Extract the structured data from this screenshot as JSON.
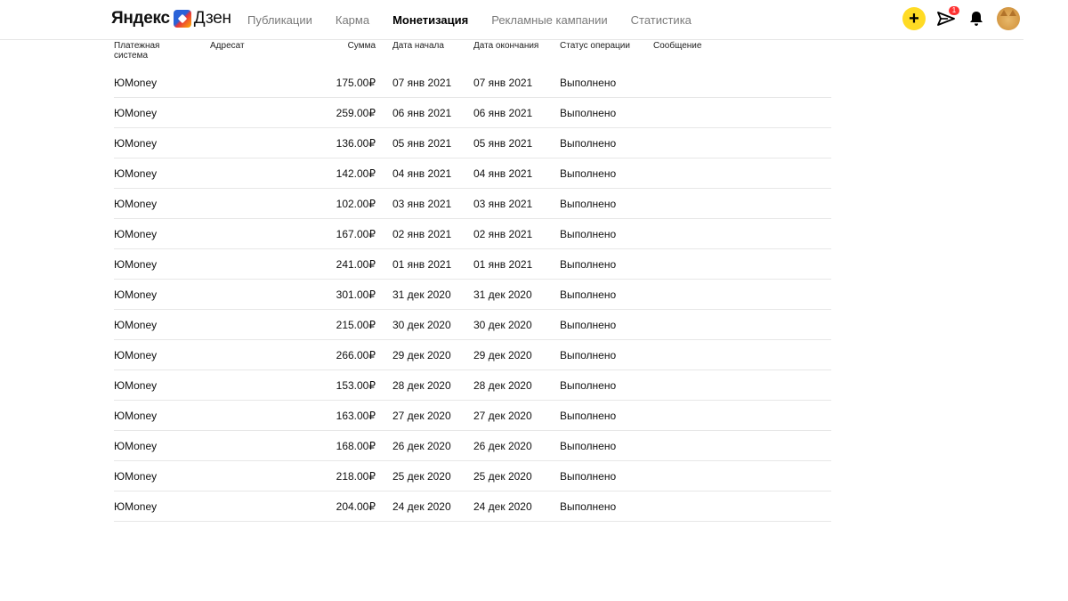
{
  "logo": {
    "word1": "Яндекс",
    "word2": "Дзен"
  },
  "nav": {
    "tabs": [
      {
        "label": "Публикации",
        "active": false
      },
      {
        "label": "Карма",
        "active": false
      },
      {
        "label": "Монетизация",
        "active": true
      },
      {
        "label": "Рекламные кампании",
        "active": false
      },
      {
        "label": "Статистика",
        "active": false
      }
    ]
  },
  "header_actions": {
    "add_icon": "plus-icon",
    "messages_icon": "paper-plane-icon",
    "messages_badge": "1",
    "notifications_icon": "bell-icon",
    "avatar_icon": "cat-avatar"
  },
  "colors": {
    "accent_yellow": "#ffdb24",
    "badge_red": "#ff3333",
    "muted_text": "#7a7a7a",
    "divider": "#e7e7e7"
  },
  "table": {
    "headers": {
      "system": "Платежная система",
      "recipient": "Адресат",
      "amount": "Сумма",
      "start_date": "Дата начала",
      "end_date": "Дата окончания",
      "status": "Статус операции",
      "message": "Сообщение"
    },
    "rows": [
      {
        "system": "ЮMoney",
        "amount": "175.00₽",
        "start": "07 янв 2021",
        "end": "07 янв 2021",
        "status": "Выполнено"
      },
      {
        "system": "ЮMoney",
        "amount": "259.00₽",
        "start": "06 янв 2021",
        "end": "06 янв 2021",
        "status": "Выполнено"
      },
      {
        "system": "ЮMoney",
        "amount": "136.00₽",
        "start": "05 янв 2021",
        "end": "05 янв 2021",
        "status": "Выполнено"
      },
      {
        "system": "ЮMoney",
        "amount": "142.00₽",
        "start": "04 янв 2021",
        "end": "04 янв 2021",
        "status": "Выполнено"
      },
      {
        "system": "ЮMoney",
        "amount": "102.00₽",
        "start": "03 янв 2021",
        "end": "03 янв 2021",
        "status": "Выполнено"
      },
      {
        "system": "ЮMoney",
        "amount": "167.00₽",
        "start": "02 янв 2021",
        "end": "02 янв 2021",
        "status": "Выполнено"
      },
      {
        "system": "ЮMoney",
        "amount": "241.00₽",
        "start": "01 янв 2021",
        "end": "01 янв 2021",
        "status": "Выполнено"
      },
      {
        "system": "ЮMoney",
        "amount": "301.00₽",
        "start": "31 дек 2020",
        "end": "31 дек 2020",
        "status": "Выполнено"
      },
      {
        "system": "ЮMoney",
        "amount": "215.00₽",
        "start": "30 дек 2020",
        "end": "30 дек 2020",
        "status": "Выполнено"
      },
      {
        "system": "ЮMoney",
        "amount": "266.00₽",
        "start": "29 дек 2020",
        "end": "29 дек 2020",
        "status": "Выполнено"
      },
      {
        "system": "ЮMoney",
        "amount": "153.00₽",
        "start": "28 дек 2020",
        "end": "28 дек 2020",
        "status": "Выполнено"
      },
      {
        "system": "ЮMoney",
        "amount": "163.00₽",
        "start": "27 дек 2020",
        "end": "27 дек 2020",
        "status": "Выполнено"
      },
      {
        "system": "ЮMoney",
        "amount": "168.00₽",
        "start": "26 дек 2020",
        "end": "26 дек 2020",
        "status": "Выполнено"
      },
      {
        "system": "ЮMoney",
        "amount": "218.00₽",
        "start": "25 дек 2020",
        "end": "25 дек 2020",
        "status": "Выполнено"
      },
      {
        "system": "ЮMoney",
        "amount": "204.00₽",
        "start": "24 дек 2020",
        "end": "24 дек 2020",
        "status": "Выполнено"
      }
    ]
  }
}
